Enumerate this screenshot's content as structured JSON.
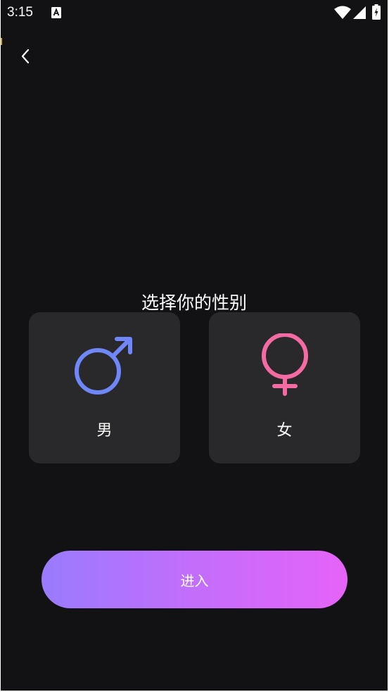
{
  "status_bar": {
    "time": "3:15"
  },
  "header": {
    "back_icon": "chevron-left-icon"
  },
  "main": {
    "title": "选择你的性别",
    "options": [
      {
        "label": "男",
        "icon": "male-symbol-icon",
        "color": "#6f87f8"
      },
      {
        "label": "女",
        "icon": "female-symbol-icon",
        "color": "#f36ba2"
      }
    ]
  },
  "enter_button": {
    "label": "进入",
    "gradient_start": "#9a7bfc",
    "gradient_end": "#e663f9"
  },
  "colors": {
    "background": "#121114",
    "card": "#29292b",
    "text": "#ffffff"
  }
}
